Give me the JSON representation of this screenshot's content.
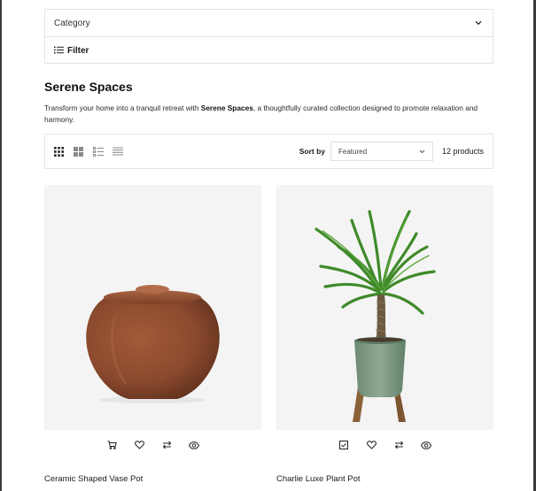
{
  "filters": {
    "category_label": "Category",
    "filter_label": "Filter"
  },
  "collection": {
    "title": "Serene Spaces",
    "desc_before": "Transform your home into a tranquil retreat with ",
    "desc_bold": "Serene Spaces",
    "desc_after": ", a thoughtfully curated collection designed to promote relaxation and harmony."
  },
  "toolbar": {
    "view_modes": [
      "grid-3-icon",
      "grid-2-icon",
      "list-numbered-icon",
      "list-icon"
    ],
    "sort_label": "Sort by",
    "sort_value": "Featured",
    "product_count": "12 products"
  },
  "products": [
    {
      "name": "Ceramic Shaped Vase Pot",
      "image": "ceramic-vase-pot",
      "actions": [
        "cart-icon",
        "heart-icon",
        "compare-icon",
        "eye-icon"
      ]
    },
    {
      "name": "Charlie Luxe Plant Pot",
      "image": "yucca-plant-pot",
      "actions": [
        "check-square-icon",
        "heart-icon",
        "compare-icon",
        "eye-icon"
      ]
    }
  ],
  "colors": {
    "border": "#e4e4e4",
    "image_bg": "#f4f4f4",
    "vase": "#8b4a2e",
    "pot": "#7e9a84",
    "stand": "#8a6238",
    "leaf": "#3f8a2a"
  }
}
